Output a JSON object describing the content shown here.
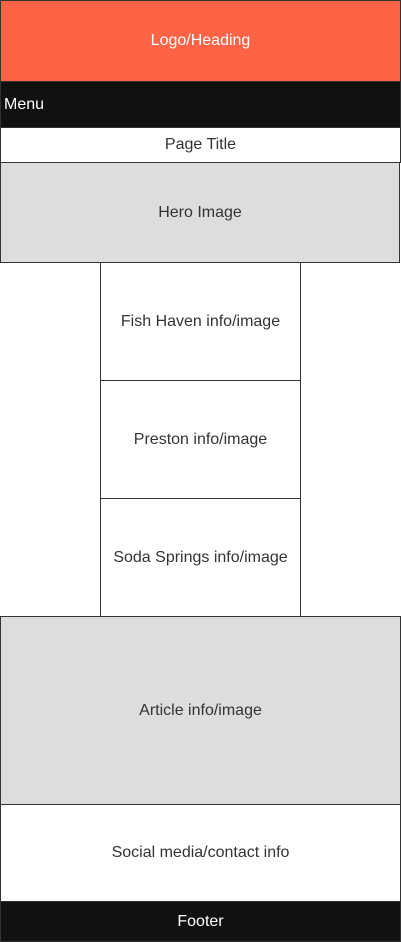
{
  "header": {
    "label": "Logo/Heading"
  },
  "menu": {
    "label": "Menu"
  },
  "page_title": {
    "label": "Page Title"
  },
  "hero": {
    "label": "Hero Image"
  },
  "towns": [
    {
      "label": "Fish Haven info/image"
    },
    {
      "label": "Preston info/image"
    },
    {
      "label": "Soda Springs info/image"
    }
  ],
  "article": {
    "label": "Article info/image"
  },
  "social": {
    "label": "Social media/contact info"
  },
  "footer": {
    "label": "Footer"
  },
  "colors": {
    "header_bg": "#ff6346",
    "dark_bg": "#111111",
    "placeholder_bg": "#dddddd",
    "border": "#333333"
  }
}
